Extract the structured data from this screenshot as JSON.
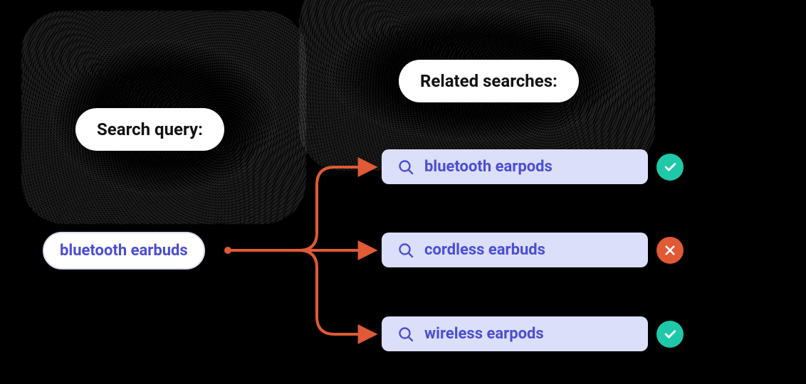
{
  "labels": {
    "search_query": "Search query:",
    "related_searches": "Related searches:"
  },
  "query": "bluetooth earbuds",
  "related": [
    {
      "text": "bluetooth earpods",
      "status": "ok"
    },
    {
      "text": "cordless earbuds",
      "status": "bad"
    },
    {
      "text": "wireless earpods",
      "status": "ok"
    }
  ],
  "colors": {
    "connector": "#df5a35",
    "chip_bg": "#dcdffa",
    "chip_text": "#4b4ed1",
    "ok": "#1fc8a9",
    "bad": "#df5a35"
  }
}
